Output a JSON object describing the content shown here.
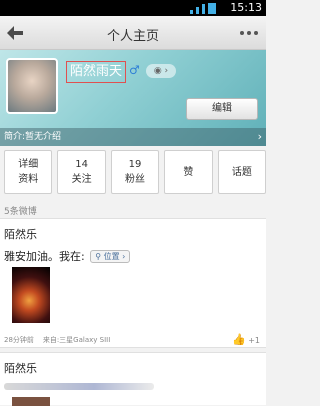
{
  "statusbar": {
    "time": "15:13"
  },
  "titlebar": {
    "title": "个人主页"
  },
  "profile": {
    "nickname": "陌然雨天",
    "gender_symbol": "♂",
    "bio": "简介:暂无介绍",
    "edit_label": "编辑"
  },
  "stats": [
    {
      "top": "详细",
      "bottom": "资料"
    },
    {
      "top": "14",
      "bottom": "关注"
    },
    {
      "top": "19",
      "bottom": "粉丝"
    },
    {
      "top": "赞",
      "bottom": ""
    },
    {
      "top": "话题",
      "bottom": ""
    }
  ],
  "weibo": {
    "count_label": "5条微博",
    "posts": [
      {
        "author": "陌然乐",
        "content": "雅安加油。我在:",
        "location_tag": "位置",
        "time": "28分钟前",
        "source": "来自:三星Galaxy SIII",
        "likes": "+1"
      },
      {
        "author": "陌然乐"
      }
    ]
  },
  "colors": {
    "accent": "#43b0e6",
    "highlight_border": "#e05050",
    "link": "#4a6f9a"
  }
}
